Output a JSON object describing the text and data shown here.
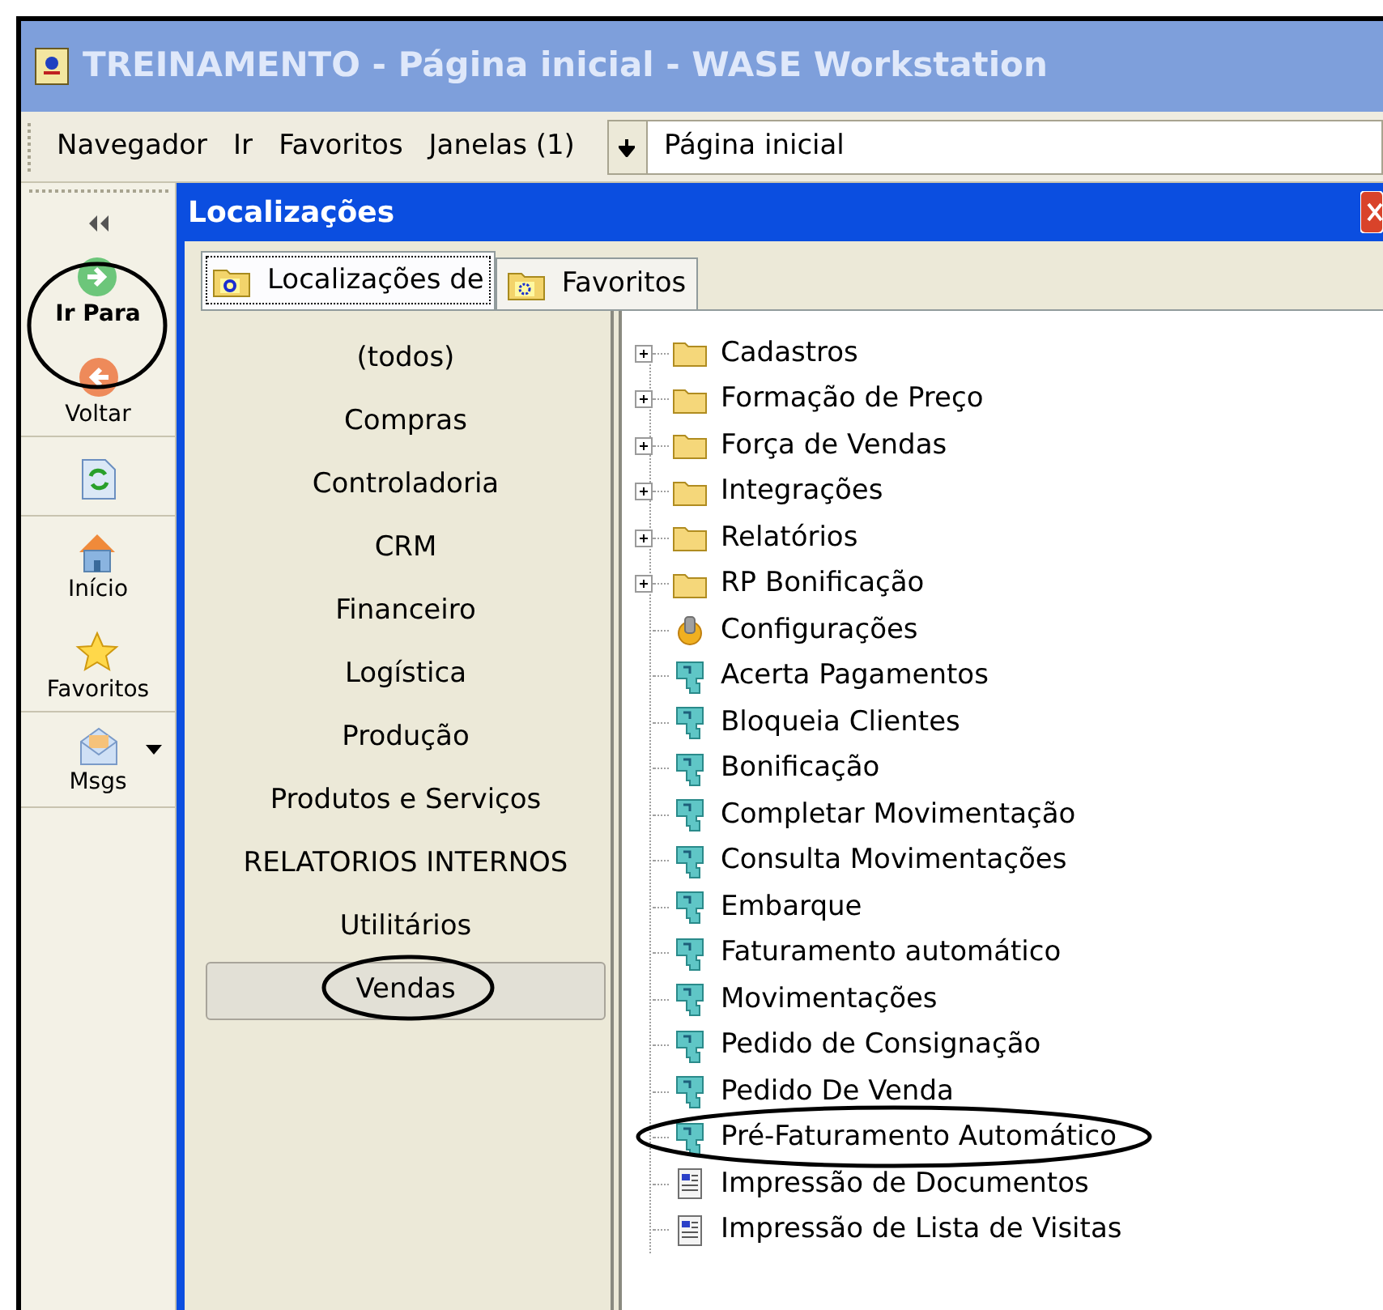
{
  "window": {
    "title": "TREINAMENTO - Página inicial - WASE Workstation"
  },
  "menu_bar": {
    "items": [
      "Navegador",
      "Ir",
      "Favoritos",
      "Janelas (1)"
    ],
    "address": "Página inicial"
  },
  "sidebar": {
    "items": [
      {
        "kind": "go",
        "label": "Ir Para"
      },
      {
        "kind": "back",
        "label": "Voltar"
      },
      {
        "kind": "refresh"
      },
      {
        "kind": "home",
        "label": "Início"
      },
      {
        "kind": "star",
        "label": "Favoritos"
      },
      {
        "kind": "mail",
        "label": "Msgs"
      }
    ]
  },
  "panel": {
    "title": "Localizações",
    "tabs": [
      {
        "label": "Localizações de",
        "kind": "locations",
        "selected": true
      },
      {
        "label": "Favoritos",
        "kind": "favorites",
        "selected": false
      }
    ],
    "categories": [
      {
        "label": "(todos)",
        "selected": false
      },
      {
        "label": "Compras",
        "selected": false
      },
      {
        "label": "Controladoria",
        "selected": false
      },
      {
        "label": "CRM",
        "selected": false
      },
      {
        "label": "Financeiro",
        "selected": false
      },
      {
        "label": "Logística",
        "selected": false
      },
      {
        "label": "Produção",
        "selected": false
      },
      {
        "label": "Produtos e Serviços",
        "selected": false
      },
      {
        "label": "RELATORIOS INTERNOS",
        "selected": false
      },
      {
        "label": "Utilitários",
        "selected": false
      },
      {
        "label": "Vendas",
        "selected": true
      }
    ],
    "tree": [
      {
        "kind": "folder",
        "label": "Cadastros",
        "expanded": false
      },
      {
        "kind": "folder",
        "label": "Formação de Preço",
        "expanded": false
      },
      {
        "kind": "folder",
        "label": "Força de Vendas",
        "expanded": false
      },
      {
        "kind": "folder",
        "label": "Integrações",
        "expanded": false
      },
      {
        "kind": "folder",
        "label": "Relatórios",
        "expanded": false
      },
      {
        "kind": "folder",
        "label": "RP Bonificação",
        "expanded": false
      },
      {
        "kind": "config",
        "label": "Configurações"
      },
      {
        "kind": "module",
        "label": "Acerta Pagamentos"
      },
      {
        "kind": "module",
        "label": "Bloqueia Clientes"
      },
      {
        "kind": "module",
        "label": "Bonificação"
      },
      {
        "kind": "module",
        "label": "Completar Movimentação"
      },
      {
        "kind": "module",
        "label": "Consulta Movimentações"
      },
      {
        "kind": "module",
        "label": "Embarque"
      },
      {
        "kind": "module",
        "label": "Faturamento automático"
      },
      {
        "kind": "module",
        "label": "Movimentações"
      },
      {
        "kind": "module",
        "label": "Pedido de Consignação"
      },
      {
        "kind": "module",
        "label": "Pedido De Venda"
      },
      {
        "kind": "module",
        "label": "Pré-Faturamento Automático"
      },
      {
        "kind": "report",
        "label": "Impressão de Documentos"
      },
      {
        "kind": "report",
        "label": "Impressão de Lista de Visitas"
      }
    ]
  }
}
